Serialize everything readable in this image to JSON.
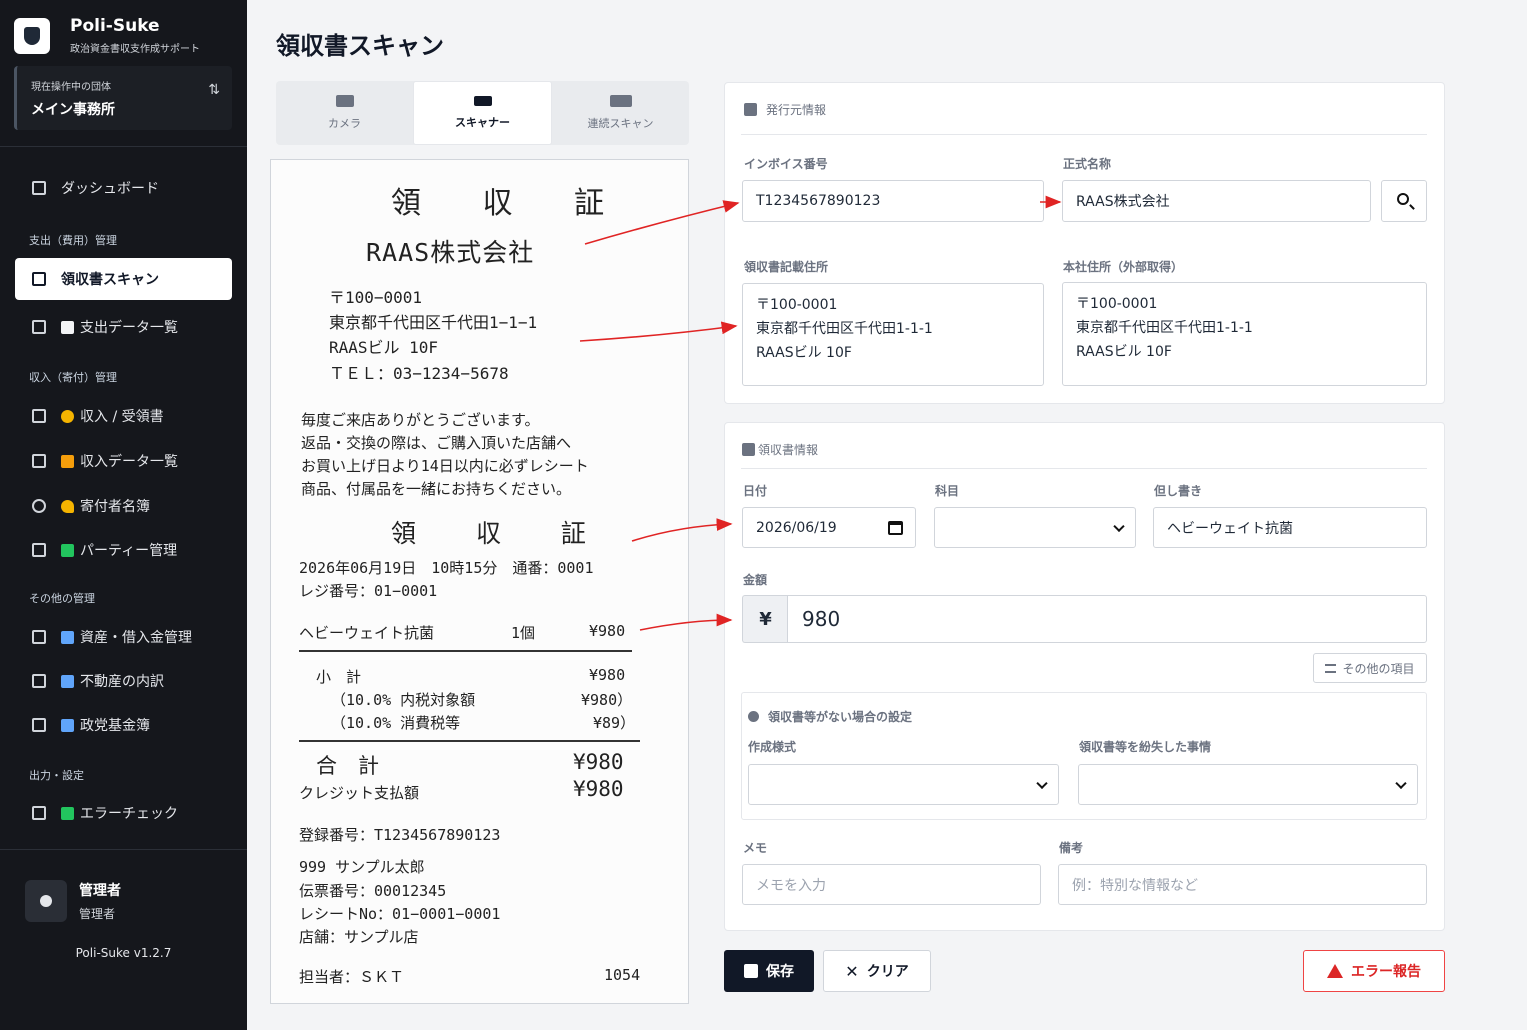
{
  "app": {
    "name": "Poli-Suke",
    "subtitle": "政治資金書収支作成サポート",
    "version": "Poli-Suke v1.2.7"
  },
  "org": {
    "label": "現在操作中の団体",
    "name": "メイン事務所"
  },
  "sidebar": {
    "items": [
      {
        "label": "ダッシュボード"
      },
      {
        "label": "領収書スキャン"
      },
      {
        "label": "支出データ一覧"
      },
      {
        "label": "収入 / 受領書"
      },
      {
        "label": "収入データ一覧"
      },
      {
        "label": "寄付者名簿"
      },
      {
        "label": "パーティー管理"
      },
      {
        "label": "資産・借入金管理"
      },
      {
        "label": "不動産の内訳"
      },
      {
        "label": "政党基金簿"
      },
      {
        "label": "エラーチェック"
      }
    ],
    "sections": [
      "支出（費用）管理",
      "収入（寄付）管理",
      "その他の管理",
      "出力・設定"
    ]
  },
  "user": {
    "name": "管理者",
    "role": "管理者"
  },
  "page": {
    "title": "領収書スキャン"
  },
  "tabs": [
    {
      "label": "カメラ"
    },
    {
      "label": "スキャナー"
    },
    {
      "label": "連続スキャン"
    }
  ],
  "receipt": {
    "title": "領 収 証",
    "company": "RAAS株式会社",
    "postal": "〒100−0001",
    "address": "東京都千代田区千代田1−1−1",
    "building": "RAASビル 10F",
    "tel": "ＴＥＬ：03−1234−5678",
    "msg1": "毎度ご来店ありがとうございます。",
    "msg2": "返品・交換の際は、ご購入頂いた店舗へ",
    "msg3": "お買い上げ日より14日以内に必ずレシート",
    "msg4": "商品、付属品を一緒にお持ちください。",
    "title2": "領 収 証",
    "datetime": "2026年06月19日　10時15分　通番：0001",
    "register": "レジ番号：01−0001",
    "item_name": "ヘビーウェイト抗菌",
    "item_qty": "1個",
    "item_price": "¥980",
    "subtotal_label": "小　計",
    "subtotal": "¥980",
    "tax_base_label": "（10.0% 内税対象額",
    "tax_base": "¥980）",
    "tax_label": "（10.0% 消費税等",
    "tax": "¥89）",
    "total_label": "合　計",
    "total": "¥980",
    "credit_label": "クレジット支払額",
    "credit": "¥980",
    "reg_number": "登録番号：T1234567890123",
    "customer": "999 サンプル太郎",
    "slip": "伝票番号：00012345",
    "receipt_no": "レシートNo：01−0001−0001",
    "store": "店舗：サンプル店",
    "staff": "担当者：ＳＫＴ",
    "staff_code": "1054"
  },
  "issuer": {
    "header": "発行元情報",
    "invoice_label": "インボイス番号",
    "invoice_value": "T1234567890123",
    "name_label": "正式名称",
    "name_value": "RAAS株式会社",
    "addr_label": "領収書記載住所",
    "addr_lines": [
      "〒100-0001",
      "東京都千代田区千代田1-1-1",
      "RAASビル 10F"
    ],
    "hq_label": "本社住所（外部取得）",
    "hq_lines": [
      "〒100-0001",
      "東京都千代田区千代田1-1-1",
      "RAASビル 10F"
    ]
  },
  "receipt_info": {
    "header": "領収書情報",
    "date_label": "日付",
    "date_value": "2026/06/19",
    "subject_label": "科目",
    "note_label": "但し書き",
    "note_value": "ヘビーウェイト抗菌",
    "amount_label": "金額",
    "currency": "¥",
    "amount_value": "980",
    "other_button": "その他の項目",
    "no_receipt_header": "領収書等がない場合の設定",
    "format_label": "作成様式",
    "lost_label": "領収書等を紛失した事情",
    "memo_label": "メモ",
    "memo_placeholder": "メモを入力",
    "remarks_label": "備考",
    "remarks_placeholder": "例：特別な情報など"
  },
  "actions": {
    "save": "保存",
    "clear": "クリア",
    "error_report": "エラー報告"
  },
  "colors": {
    "sidebar_bg": "#15171c",
    "accent": "#111827",
    "arrow": "#e02424",
    "error": "#dc2626"
  }
}
